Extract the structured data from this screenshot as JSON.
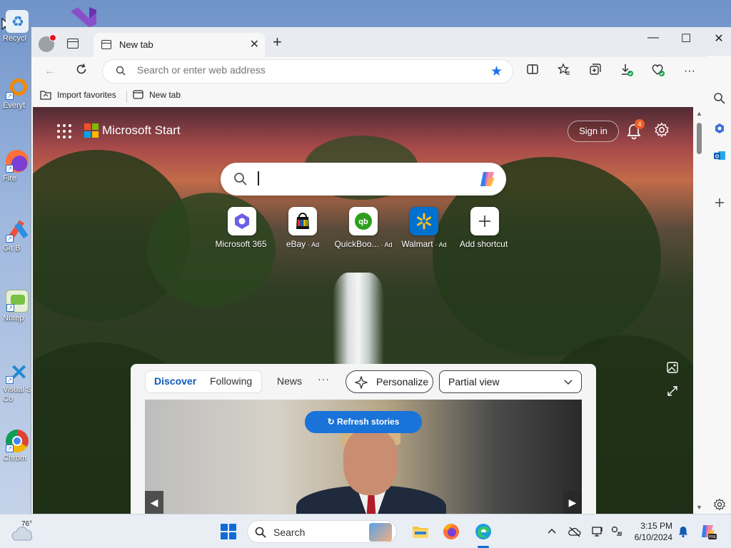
{
  "desktop": {
    "icons": [
      {
        "label": "Recycl"
      },
      {
        "label": "Everyt"
      },
      {
        "label": "Fire"
      },
      {
        "label": "Git B"
      },
      {
        "label": "Notep"
      },
      {
        "label": "Visual S\nCo"
      },
      {
        "label": "Chrom"
      }
    ]
  },
  "browser": {
    "tab": {
      "title": "New tab"
    },
    "address": {
      "placeholder": "Search or enter web address",
      "value": ""
    },
    "favorites": {
      "import_label": "Import favorites",
      "newtab_label": "New tab"
    },
    "colors": {
      "accent": "#1a73e8",
      "badge": "#f25c24"
    }
  },
  "page": {
    "brand": "Microsoft Start",
    "signin_label": "Sign in",
    "notification_count": "4",
    "quick_links": [
      {
        "label": "Microsoft 365",
        "ad": ""
      },
      {
        "label": "eBay",
        "ad": "· Ad"
      },
      {
        "label": "QuickBoo...",
        "ad": "· Ad"
      },
      {
        "label": "Walmart",
        "ad": "· Ad"
      },
      {
        "label": "Add shortcut",
        "ad": ""
      }
    ],
    "feed": {
      "tabs": [
        "Discover",
        "Following"
      ],
      "news_label": "News",
      "more_label": "···",
      "personalize_label": "Personalize",
      "view_label": "Partial view",
      "refresh_label": "Refresh stories"
    }
  },
  "taskbar": {
    "temperature": "76°",
    "search_label": "Search",
    "time": "3:15 PM",
    "date": "6/10/2024"
  }
}
